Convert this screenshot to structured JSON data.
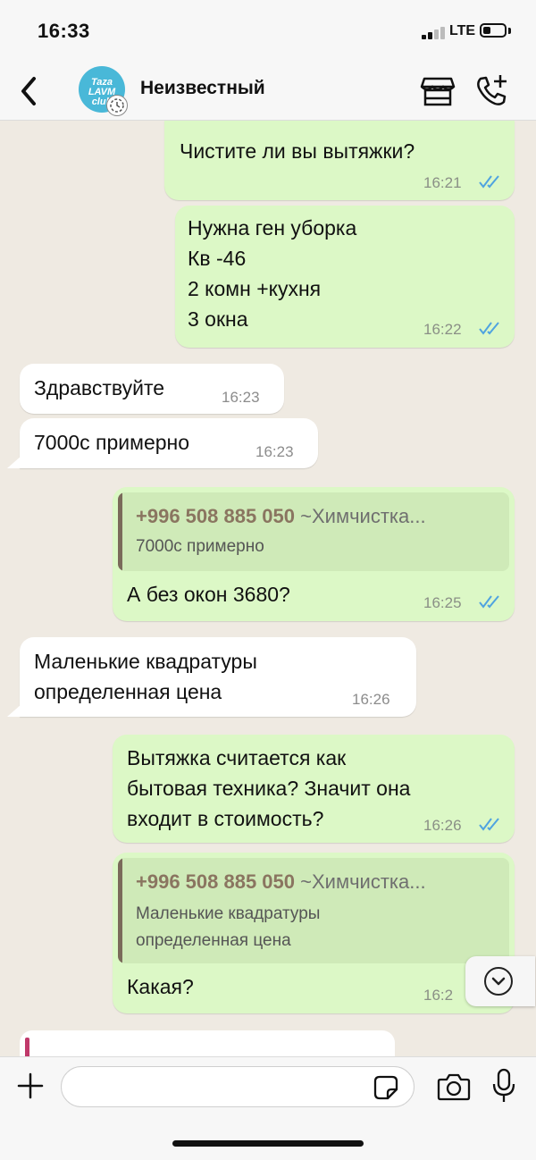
{
  "status_bar": {
    "time": "16:33",
    "network": "LTE",
    "battery_level": 0.35
  },
  "header": {
    "contact_name": "Неизвестный",
    "avatar_text": "Taza\nLAVM\nclub"
  },
  "colors": {
    "outgoing_bubble": "#dcf8c6",
    "incoming_bubble": "#ffffff",
    "chat_background": "#efeae2",
    "read_ticks": "#4fa3e0"
  },
  "messages": [
    {
      "direction": "out",
      "text": "Чистите ли вы вытяжки?",
      "time": "16:21",
      "read": true
    },
    {
      "direction": "out",
      "text": "Нужна ген уборка\nКв -46\n2 комн +кухня\n3 окна",
      "time": "16:22",
      "read": true
    },
    {
      "direction": "in",
      "text": "Здравствуйте",
      "time": "16:23"
    },
    {
      "direction": "in",
      "text": "7000с примерно",
      "time": "16:23"
    },
    {
      "direction": "out",
      "quote": {
        "author": "+996 508 885 050",
        "author_suffix": "~Химчистка...",
        "text": "7000с примерно"
      },
      "text": "А без окон 3680?",
      "time": "16:25",
      "read": true
    },
    {
      "direction": "in",
      "text": "Маленькие квадратуры\nопределенная цена",
      "time": "16:26"
    },
    {
      "direction": "out",
      "text": "Вытяжка считается как\nбытовая техника? Значит она\nвходит в стоимость?",
      "time": "16:26",
      "read": true
    },
    {
      "direction": "out",
      "quote": {
        "author": "+996 508 885 050",
        "author_suffix": "~Химчистка...",
        "text": "Маленькие квадратуры\nопределенная цена"
      },
      "text": "Какая?",
      "time": "16:2"
    }
  ],
  "input": {
    "placeholder": ""
  }
}
